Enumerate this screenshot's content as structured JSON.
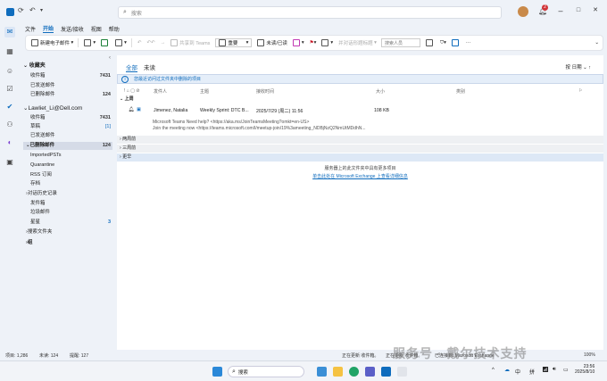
{
  "titlebar": {
    "search_placeholder": "搜索",
    "minimize": "–",
    "maximize": "□",
    "close": "✕",
    "badge_count": "2"
  },
  "menu": [
    "文件",
    "开始",
    "发送/接收",
    "视图",
    "帮助"
  ],
  "ribbon": {
    "new_email": "新建电子邮件",
    "share_teams": "共享到 Teams",
    "move": "重要",
    "unread_read": "未读/已读",
    "reply_options": "并对话形题标题",
    "people_search": "搜索人员"
  },
  "folders": {
    "favorites_header": "收藏夹",
    "favorites": [
      {
        "label": "收件箱",
        "count": "7431"
      },
      {
        "label": "已发送邮件",
        "count": ""
      },
      {
        "label": "已删除邮件",
        "count": "124"
      }
    ],
    "account": "Lawliet_Li@Dell.com",
    "account_folders": [
      {
        "label": "收件箱",
        "count": "7431"
      },
      {
        "label": "草稿",
        "count": "[1]"
      },
      {
        "label": "已发送邮件",
        "count": ""
      },
      {
        "label": "已删除邮件",
        "count": "124"
      },
      {
        "label": "ImportedPSTs",
        "count": ""
      },
      {
        "label": "Quarantine",
        "count": ""
      },
      {
        "label": "RSS 订阅",
        "count": ""
      },
      {
        "label": "存档",
        "count": ""
      },
      {
        "label": "对话历史记录",
        "count": ""
      },
      {
        "label": "发件箱",
        "count": ""
      },
      {
        "label": "垃圾邮件",
        "count": ""
      },
      {
        "label": "星星",
        "count": "3"
      },
      {
        "label": "搜索文件夹",
        "count": ""
      },
      {
        "label": "组",
        "count": ""
      }
    ]
  },
  "list": {
    "tab_all": "全部",
    "tab_unread": "未读",
    "sort_label": "按 日期",
    "info_bar": "您最近访问过文件夹中删除的项目",
    "columns": [
      "发件人",
      "主题",
      "接收时间",
      "大小",
      "类别"
    ],
    "group_today": "上周",
    "message": {
      "from": "Jimenez, Natalia",
      "subject": "Weekly Sprint: DTC B...",
      "received": "2025/7/29 (周二) 11:56",
      "size": "108 KB",
      "preview_line1": "Microsoft Teams Need help? <https://aka.ms/JoinTeamsMeeting?omkt=en-US>",
      "preview_line2": "Join the meeting now <https://teams.microsoft.com/l/meetup-join/19%3ameeting_NDBjNzQ2NmUtMDdhN..."
    },
    "group_two_weeks": "两周前",
    "group_three_weeks": "三周前",
    "group_older": "更早",
    "server_note": "服务器上的此文件夹中具有更多项目",
    "server_link": "单击此处在 Microsoft Exchange 上查看详细信息"
  },
  "status": {
    "items": "项目: 1,286",
    "unread": "未读: 124",
    "reminders": "提醒: 127",
    "updating": "正在更新 收件箱。",
    "updating2": "正在更新 收件箱。",
    "connected": "已连接到: Microsoft Exchange",
    "zoom": "100%"
  },
  "watermark": "服务号 · 戴尔技术支持",
  "taskbar": {
    "search": "搜索",
    "lang": "中",
    "ime": "拼",
    "time": "23:56",
    "date": "2025/8/10"
  }
}
